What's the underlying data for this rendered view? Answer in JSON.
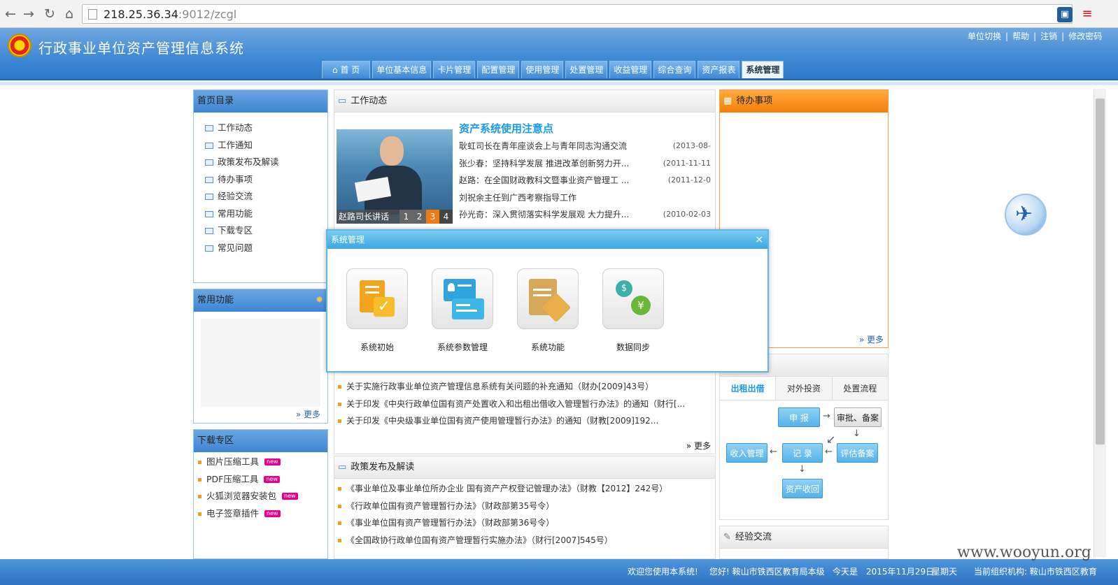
{
  "browser": {
    "url_host": "218.25.36.34",
    "url_path": ":9012/zcgl"
  },
  "header": {
    "title": "行政事业单位资产管理信息系统",
    "links": [
      "单位切换",
      "帮助",
      "注销",
      "修改密码"
    ],
    "link_sep": "|",
    "tabs": [
      "首 页",
      "单位基本信息",
      "卡片管理",
      "配置管理",
      "使用管理",
      "处置管理",
      "收益管理",
      "综合查询",
      "资产报表",
      "系统管理"
    ],
    "active_tab": "系统管理"
  },
  "sidebar": {
    "directory": {
      "title": "首页目录",
      "items": [
        "工作动态",
        "工作通知",
        "政策发布及解读",
        "待办事项",
        "经验交流",
        "常用功能",
        "下载专区",
        "常见问题"
      ]
    },
    "common": {
      "title": "常用功能",
      "more": "更多"
    },
    "download": {
      "title": "下载专区",
      "new_badge": "new",
      "items": [
        "图片压缩工具",
        "PDF压缩工具",
        "火狐浏览器安装包",
        "电子签章插件"
      ]
    }
  },
  "work_news": {
    "title": "工作动态",
    "photo_caption": "赵路司长讲话",
    "pager": [
      "1",
      "2",
      "3",
      "4"
    ],
    "active_page": "3",
    "headline": "资产系统使用注意点",
    "rows": [
      {
        "text": "耿虹司长在青年座谈会上与青年同志沟通交流",
        "date": "(2013-08-"
      },
      {
        "text": "张少春：坚持科学发展 推进改革创新努力开...",
        "date": "(2011-11-11"
      },
      {
        "text": "赵路：在全国财政教科文暨事业资产管理工  ...",
        "date": "(2011-12-0"
      },
      {
        "text": "刘祝余主任到广西考察指导工作",
        "date": ""
      },
      {
        "text": "孙光奇：深入贯彻落实科学发展观 大力提升...",
        "date": "(2010-02-03"
      }
    ]
  },
  "notices": {
    "rows": [
      "关于实施行政事业单位资产管理信息系统有关问题的补充通知（财办[2009]43号）",
      "关于印发《中央行政单位国有资产处置收入和出租出借收入管理暂行办法》的通知（财行[...",
      "关于印发《中央级事业单位国有资产使用管理暂行办法》的通知（财教[2009]192..."
    ],
    "more": "更多"
  },
  "policy": {
    "title": "政策发布及解读",
    "rows": [
      "《事业单位及事业单位所办企业 国有资产产权登记管理办法》（财教【2012】242号）",
      "《行政单位国有资产管理暂行办法》（财政部第35号令）",
      "《事业单位国有资产管理暂行办法》（财政部第36号令）",
      "《全国政协行政单位国有资产管理暂行实施办法》（财行[2007]545号）"
    ]
  },
  "todo": {
    "title": "待办事项",
    "more": "更多"
  },
  "flow": {
    "tabs": [
      "出租出借",
      "对外投资",
      "处置流程"
    ],
    "active_tab": "出租出借",
    "nodes": {
      "report": "申 报",
      "approve": "审批、备案",
      "record": "记 录",
      "income": "收入管理",
      "assess": "评估备案",
      "recover": "资产收回"
    }
  },
  "experience": {
    "title": "经验交流"
  },
  "modal": {
    "title": "系统管理",
    "close": "×",
    "items": [
      "系统初始",
      "系统参数管理",
      "系统功能",
      "数据同步"
    ]
  },
  "footer": {
    "welcome": "欢迎您使用本系统!",
    "hello": "您好!  鞍山市铁西区教育局本级",
    "today_label": "今天是",
    "date": "2015年11月29日",
    "weekday": "星期天",
    "org": "当前组织机构: 鞍山市铁西区教育"
  },
  "watermark": "www.wooyun.org",
  "colors": {
    "header_blue": "#3f88d4",
    "todo_orange": "#f57f07",
    "modal_blue": "#3aa8e0",
    "link_blue": "#1a9ae6"
  }
}
